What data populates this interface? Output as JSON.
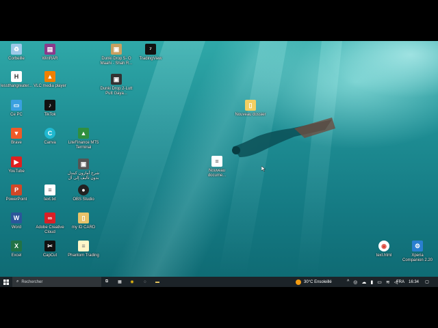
{
  "desktop": {
    "icons": [
      {
        "label": "Corbeille",
        "icon": "recycle-bin-icon",
        "color": "#9cc9e8",
        "glyph": "♻"
      },
      {
        "label": "WinRAR",
        "icon": "winrar-icon",
        "color": "#8b3a8b",
        "glyph": "▤"
      },
      {
        "label": "lessthangreater...",
        "icon": "document-icon",
        "color": "#ffffff",
        "glyph": "H"
      },
      {
        "label": "VLC media player",
        "icon": "vlc-icon",
        "color": "#f08000",
        "glyph": "▲"
      },
      {
        "label": "Ce PC",
        "icon": "computer-icon",
        "color": "#3aa0e0",
        "glyph": "▭"
      },
      {
        "label": "TikTok",
        "icon": "tiktok-icon",
        "color": "#111111",
        "glyph": "♪"
      },
      {
        "label": "Brave",
        "icon": "brave-icon",
        "color": "#f05a28",
        "glyph": "▼"
      },
      {
        "label": "Canva",
        "icon": "canva-icon",
        "color": "#20b8d0",
        "glyph": "C"
      },
      {
        "label": "LiteFinance MT5 Terminal",
        "icon": "mt5-icon",
        "color": "#2f8f3f",
        "glyph": "▲"
      },
      {
        "label": "YouTube",
        "icon": "youtube-icon",
        "color": "#e02020",
        "glyph": "▶"
      },
      {
        "label": "شرح أمازون كيندل بدون تأليف إلى آل",
        "icon": "video-file-icon",
        "color": "#555555",
        "glyph": "▣"
      },
      {
        "label": "PowerPoint",
        "icon": "powerpoint-icon",
        "color": "#d24726",
        "glyph": "P"
      },
      {
        "label": "text.txt",
        "icon": "text-file-icon",
        "color": "#ffffff",
        "glyph": "≡"
      },
      {
        "label": "OBS Studio",
        "icon": "obs-icon",
        "color": "#222222",
        "glyph": "●"
      },
      {
        "label": "Word",
        "icon": "word-icon",
        "color": "#2b579a",
        "glyph": "W"
      },
      {
        "label": "Adobe Creative Cloud",
        "icon": "adobe-cc-icon",
        "color": "#da1f26",
        "glyph": "∞"
      },
      {
        "label": "my ID CARD",
        "icon": "folder-icon",
        "color": "#e8c36a",
        "glyph": "▯"
      },
      {
        "label": "Excel",
        "icon": "excel-icon",
        "color": "#217346",
        "glyph": "X"
      },
      {
        "label": "CapCut",
        "icon": "capcut-icon",
        "color": "#111111",
        "glyph": "✂"
      },
      {
        "label": "Phantom Trading",
        "icon": "text-file-icon",
        "color": "#fff6c8",
        "glyph": "≡"
      },
      {
        "label": "Dunki Drop 5- O Maahi - Shah R...",
        "icon": "video-file-icon",
        "color": "#c9a060",
        "glyph": "▣"
      },
      {
        "label": "TradingView",
        "icon": "tradingview-icon",
        "color": "#111111",
        "glyph": "⁷"
      },
      {
        "label": "Dunki Drop 2-Lutt Putt Gaya...",
        "icon": "video-file-icon",
        "color": "#333333",
        "glyph": "▣"
      },
      {
        "label": "Nouveau dossier",
        "icon": "folder-icon",
        "color": "#f2cf62",
        "glyph": "▯"
      },
      {
        "label": "Nouveau docume...",
        "icon": "text-file-icon",
        "color": "#ffffff",
        "glyph": "≡"
      },
      {
        "label": "text.html",
        "icon": "chrome-icon",
        "color": "#ffffff",
        "glyph": "◉"
      },
      {
        "label": "Xperia Companion 2.20",
        "icon": "xperia-icon",
        "color": "#2a7fd0",
        "glyph": "⚙"
      }
    ]
  },
  "taskbar": {
    "search_placeholder": "Rechercher",
    "weather": "30°C  Ensoleillé",
    "language": "FRA",
    "time": "16:34"
  }
}
